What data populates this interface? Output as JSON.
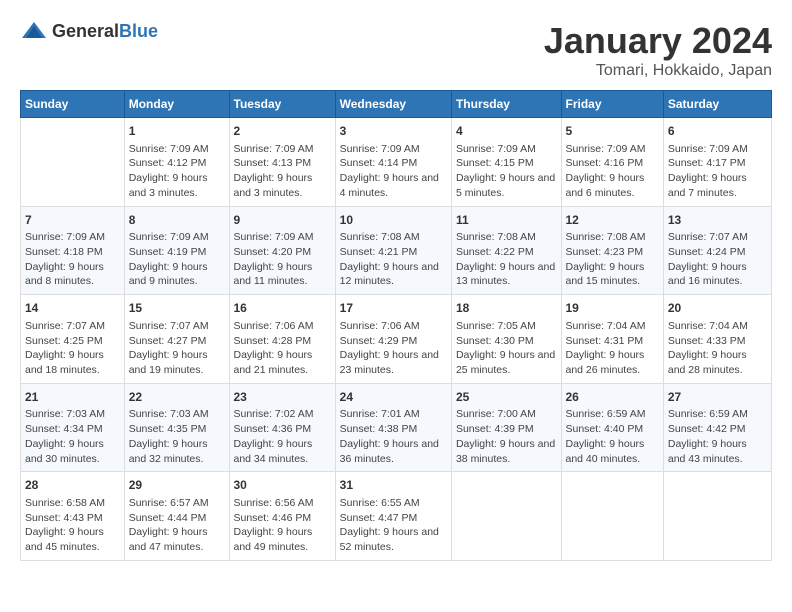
{
  "header": {
    "logo_general": "General",
    "logo_blue": "Blue",
    "title": "January 2024",
    "subtitle": "Tomari, Hokkaido, Japan"
  },
  "columns": [
    "Sunday",
    "Monday",
    "Tuesday",
    "Wednesday",
    "Thursday",
    "Friday",
    "Saturday"
  ],
  "weeks": [
    [
      {
        "day": "",
        "sunrise": "",
        "sunset": "",
        "daylight": ""
      },
      {
        "day": "1",
        "sunrise": "Sunrise: 7:09 AM",
        "sunset": "Sunset: 4:12 PM",
        "daylight": "Daylight: 9 hours and 3 minutes."
      },
      {
        "day": "2",
        "sunrise": "Sunrise: 7:09 AM",
        "sunset": "Sunset: 4:13 PM",
        "daylight": "Daylight: 9 hours and 3 minutes."
      },
      {
        "day": "3",
        "sunrise": "Sunrise: 7:09 AM",
        "sunset": "Sunset: 4:14 PM",
        "daylight": "Daylight: 9 hours and 4 minutes."
      },
      {
        "day": "4",
        "sunrise": "Sunrise: 7:09 AM",
        "sunset": "Sunset: 4:15 PM",
        "daylight": "Daylight: 9 hours and 5 minutes."
      },
      {
        "day": "5",
        "sunrise": "Sunrise: 7:09 AM",
        "sunset": "Sunset: 4:16 PM",
        "daylight": "Daylight: 9 hours and 6 minutes."
      },
      {
        "day": "6",
        "sunrise": "Sunrise: 7:09 AM",
        "sunset": "Sunset: 4:17 PM",
        "daylight": "Daylight: 9 hours and 7 minutes."
      }
    ],
    [
      {
        "day": "7",
        "sunrise": "Sunrise: 7:09 AM",
        "sunset": "Sunset: 4:18 PM",
        "daylight": "Daylight: 9 hours and 8 minutes."
      },
      {
        "day": "8",
        "sunrise": "Sunrise: 7:09 AM",
        "sunset": "Sunset: 4:19 PM",
        "daylight": "Daylight: 9 hours and 9 minutes."
      },
      {
        "day": "9",
        "sunrise": "Sunrise: 7:09 AM",
        "sunset": "Sunset: 4:20 PM",
        "daylight": "Daylight: 9 hours and 11 minutes."
      },
      {
        "day": "10",
        "sunrise": "Sunrise: 7:08 AM",
        "sunset": "Sunset: 4:21 PM",
        "daylight": "Daylight: 9 hours and 12 minutes."
      },
      {
        "day": "11",
        "sunrise": "Sunrise: 7:08 AM",
        "sunset": "Sunset: 4:22 PM",
        "daylight": "Daylight: 9 hours and 13 minutes."
      },
      {
        "day": "12",
        "sunrise": "Sunrise: 7:08 AM",
        "sunset": "Sunset: 4:23 PM",
        "daylight": "Daylight: 9 hours and 15 minutes."
      },
      {
        "day": "13",
        "sunrise": "Sunrise: 7:07 AM",
        "sunset": "Sunset: 4:24 PM",
        "daylight": "Daylight: 9 hours and 16 minutes."
      }
    ],
    [
      {
        "day": "14",
        "sunrise": "Sunrise: 7:07 AM",
        "sunset": "Sunset: 4:25 PM",
        "daylight": "Daylight: 9 hours and 18 minutes."
      },
      {
        "day": "15",
        "sunrise": "Sunrise: 7:07 AM",
        "sunset": "Sunset: 4:27 PM",
        "daylight": "Daylight: 9 hours and 19 minutes."
      },
      {
        "day": "16",
        "sunrise": "Sunrise: 7:06 AM",
        "sunset": "Sunset: 4:28 PM",
        "daylight": "Daylight: 9 hours and 21 minutes."
      },
      {
        "day": "17",
        "sunrise": "Sunrise: 7:06 AM",
        "sunset": "Sunset: 4:29 PM",
        "daylight": "Daylight: 9 hours and 23 minutes."
      },
      {
        "day": "18",
        "sunrise": "Sunrise: 7:05 AM",
        "sunset": "Sunset: 4:30 PM",
        "daylight": "Daylight: 9 hours and 25 minutes."
      },
      {
        "day": "19",
        "sunrise": "Sunrise: 7:04 AM",
        "sunset": "Sunset: 4:31 PM",
        "daylight": "Daylight: 9 hours and 26 minutes."
      },
      {
        "day": "20",
        "sunrise": "Sunrise: 7:04 AM",
        "sunset": "Sunset: 4:33 PM",
        "daylight": "Daylight: 9 hours and 28 minutes."
      }
    ],
    [
      {
        "day": "21",
        "sunrise": "Sunrise: 7:03 AM",
        "sunset": "Sunset: 4:34 PM",
        "daylight": "Daylight: 9 hours and 30 minutes."
      },
      {
        "day": "22",
        "sunrise": "Sunrise: 7:03 AM",
        "sunset": "Sunset: 4:35 PM",
        "daylight": "Daylight: 9 hours and 32 minutes."
      },
      {
        "day": "23",
        "sunrise": "Sunrise: 7:02 AM",
        "sunset": "Sunset: 4:36 PM",
        "daylight": "Daylight: 9 hours and 34 minutes."
      },
      {
        "day": "24",
        "sunrise": "Sunrise: 7:01 AM",
        "sunset": "Sunset: 4:38 PM",
        "daylight": "Daylight: 9 hours and 36 minutes."
      },
      {
        "day": "25",
        "sunrise": "Sunrise: 7:00 AM",
        "sunset": "Sunset: 4:39 PM",
        "daylight": "Daylight: 9 hours and 38 minutes."
      },
      {
        "day": "26",
        "sunrise": "Sunrise: 6:59 AM",
        "sunset": "Sunset: 4:40 PM",
        "daylight": "Daylight: 9 hours and 40 minutes."
      },
      {
        "day": "27",
        "sunrise": "Sunrise: 6:59 AM",
        "sunset": "Sunset: 4:42 PM",
        "daylight": "Daylight: 9 hours and 43 minutes."
      }
    ],
    [
      {
        "day": "28",
        "sunrise": "Sunrise: 6:58 AM",
        "sunset": "Sunset: 4:43 PM",
        "daylight": "Daylight: 9 hours and 45 minutes."
      },
      {
        "day": "29",
        "sunrise": "Sunrise: 6:57 AM",
        "sunset": "Sunset: 4:44 PM",
        "daylight": "Daylight: 9 hours and 47 minutes."
      },
      {
        "day": "30",
        "sunrise": "Sunrise: 6:56 AM",
        "sunset": "Sunset: 4:46 PM",
        "daylight": "Daylight: 9 hours and 49 minutes."
      },
      {
        "day": "31",
        "sunrise": "Sunrise: 6:55 AM",
        "sunset": "Sunset: 4:47 PM",
        "daylight": "Daylight: 9 hours and 52 minutes."
      },
      {
        "day": "",
        "sunrise": "",
        "sunset": "",
        "daylight": ""
      },
      {
        "day": "",
        "sunrise": "",
        "sunset": "",
        "daylight": ""
      },
      {
        "day": "",
        "sunrise": "",
        "sunset": "",
        "daylight": ""
      }
    ]
  ]
}
